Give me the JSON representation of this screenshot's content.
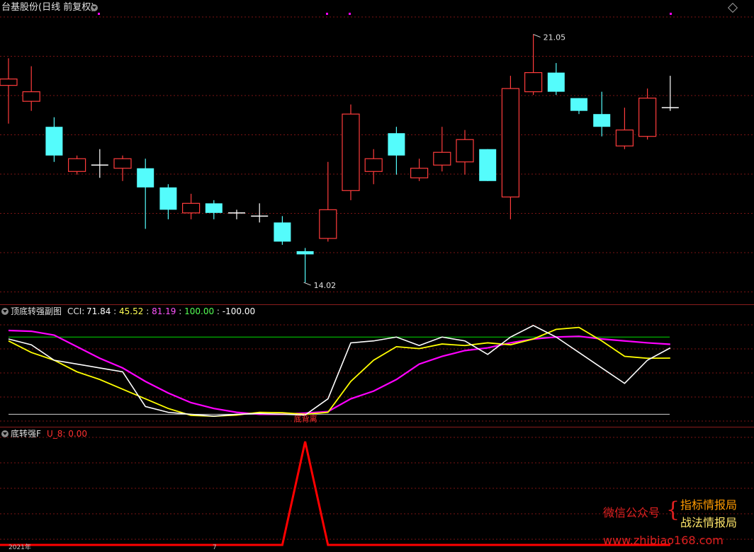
{
  "main_panel": {
    "title": "台基股份(日线 前复权)",
    "high_label": "21.05",
    "low_label": "14.02",
    "price_range": [
      13.6,
      22.3
    ],
    "candles": [
      {
        "o": 20.2,
        "h": 21.05,
        "l": 19.0,
        "c": 20.4
      },
      {
        "o": 19.7,
        "h": 20.8,
        "l": 19.4,
        "c": 20.0
      },
      {
        "o": 18.9,
        "h": 19.2,
        "l": 17.8,
        "c": 18.0
      },
      {
        "o": 17.5,
        "h": 18.0,
        "l": 17.4,
        "c": 17.9
      },
      {
        "o": 17.7,
        "h": 18.2,
        "l": 17.3,
        "c": 17.7
      },
      {
        "o": 17.6,
        "h": 18.0,
        "l": 17.2,
        "c": 17.9
      },
      {
        "o": 17.6,
        "h": 17.9,
        "l": 15.7,
        "c": 17.0
      },
      {
        "o": 17.0,
        "h": 17.1,
        "l": 16.0,
        "c": 16.3
      },
      {
        "o": 16.2,
        "h": 16.8,
        "l": 16.0,
        "c": 16.5
      },
      {
        "o": 16.5,
        "h": 16.6,
        "l": 16.0,
        "c": 16.2
      },
      {
        "o": 16.2,
        "h": 16.3,
        "l": 16.0,
        "c": 16.2
      },
      {
        "o": 16.1,
        "h": 16.5,
        "l": 15.9,
        "c": 16.1
      },
      {
        "o": 15.9,
        "h": 16.1,
        "l": 15.2,
        "c": 15.3
      },
      {
        "o": 15.0,
        "h": 15.1,
        "l": 14.02,
        "c": 14.9
      },
      {
        "o": 15.4,
        "h": 17.8,
        "l": 15.3,
        "c": 16.3
      },
      {
        "o": 16.9,
        "h": 19.6,
        "l": 16.6,
        "c": 19.3
      },
      {
        "o": 17.5,
        "h": 18.2,
        "l": 17.1,
        "c": 17.9
      },
      {
        "o": 18.7,
        "h": 18.9,
        "l": 17.4,
        "c": 18.0
      },
      {
        "o": 17.3,
        "h": 17.9,
        "l": 17.2,
        "c": 17.6
      },
      {
        "o": 17.7,
        "h": 18.9,
        "l": 17.5,
        "c": 18.1
      },
      {
        "o": 17.8,
        "h": 18.8,
        "l": 17.4,
        "c": 18.5
      },
      {
        "o": 18.2,
        "h": 18.2,
        "l": 17.2,
        "c": 17.2
      },
      {
        "o": 16.7,
        "h": 20.5,
        "l": 16.0,
        "c": 20.1
      },
      {
        "o": 20.0,
        "h": 21.8,
        "l": 19.9,
        "c": 20.6
      },
      {
        "o": 20.6,
        "h": 20.9,
        "l": 19.9,
        "c": 20.0
      },
      {
        "o": 19.8,
        "h": 19.8,
        "l": 19.3,
        "c": 19.4
      },
      {
        "o": 19.3,
        "h": 20.0,
        "l": 18.6,
        "c": 18.9
      },
      {
        "o": 18.3,
        "h": 19.5,
        "l": 18.2,
        "c": 18.8
      },
      {
        "o": 18.6,
        "h": 20.1,
        "l": 18.5,
        "c": 19.8
      },
      {
        "o": 19.5,
        "h": 20.5,
        "l": 19.4,
        "c": 19.5
      }
    ],
    "colors": {
      "up": "#ff3c3c",
      "down": "#54fcfc",
      "doji": "#ffffff",
      "grid": "#7a1414"
    }
  },
  "cci_panel": {
    "title": "顶底转强副图",
    "cci_label": "CCI:",
    "values": [
      {
        "text": "71.84",
        "color": "#ffffff"
      },
      {
        "text": "45.52",
        "color": "#ffff54"
      },
      {
        "text": "81.19",
        "color": "#ff54ff"
      },
      {
        "text": "100.00",
        "color": "#54ff54"
      },
      {
        "text": "-100.00",
        "color": "#ffffff"
      }
    ],
    "range": [
      -125,
      150
    ],
    "upper_level": 100,
    "lower_level": -100,
    "series_white": [
      95,
      80,
      40,
      30,
      20,
      10,
      -80,
      -95,
      -100,
      -105,
      -100,
      -98,
      -100,
      -102,
      -60,
      85,
      90,
      100,
      78,
      100,
      90,
      55,
      100,
      130,
      100,
      60,
      20,
      -20,
      40,
      71.84
    ],
    "series_yellow": [
      90,
      60,
      40,
      10,
      -10,
      -35,
      -60,
      -85,
      -103,
      -105,
      -102,
      -95,
      -96,
      -100,
      -95,
      -15,
      40,
      75,
      70,
      82,
      78,
      85,
      80,
      95,
      120,
      125,
      90,
      50,
      45,
      45.52
    ],
    "series_magenta": [
      117,
      115,
      105,
      75,
      45,
      20,
      -15,
      -45,
      -70,
      -85,
      -95,
      -100,
      -100,
      -97,
      -93,
      -60,
      -40,
      -10,
      30,
      50,
      65,
      72,
      85,
      95,
      100,
      102,
      95,
      90,
      85,
      81.19
    ],
    "signal_text": "底背离",
    "colors": {
      "white": "#ffffff",
      "yellow": "#ffff00",
      "magenta": "#ff00ff",
      "upper": "#00dd00",
      "lower": "#d0d0d0"
    }
  },
  "bottom_panel": {
    "title": "底转强F",
    "value_label": "U_8: 0.00",
    "spike_index": 13,
    "color": "#ff0000",
    "axis_hint_left": "2021年",
    "axis_hint_mid": "7"
  },
  "watermark": {
    "wechat": "微信公众号",
    "brand_top": "指标情报局",
    "brand_bottom": "战法情报局",
    "url": "www.zhibiao168.com",
    "colors": {
      "red": "#e02020",
      "orange": "#ff9a00",
      "yellow": "#ffe66a"
    }
  }
}
